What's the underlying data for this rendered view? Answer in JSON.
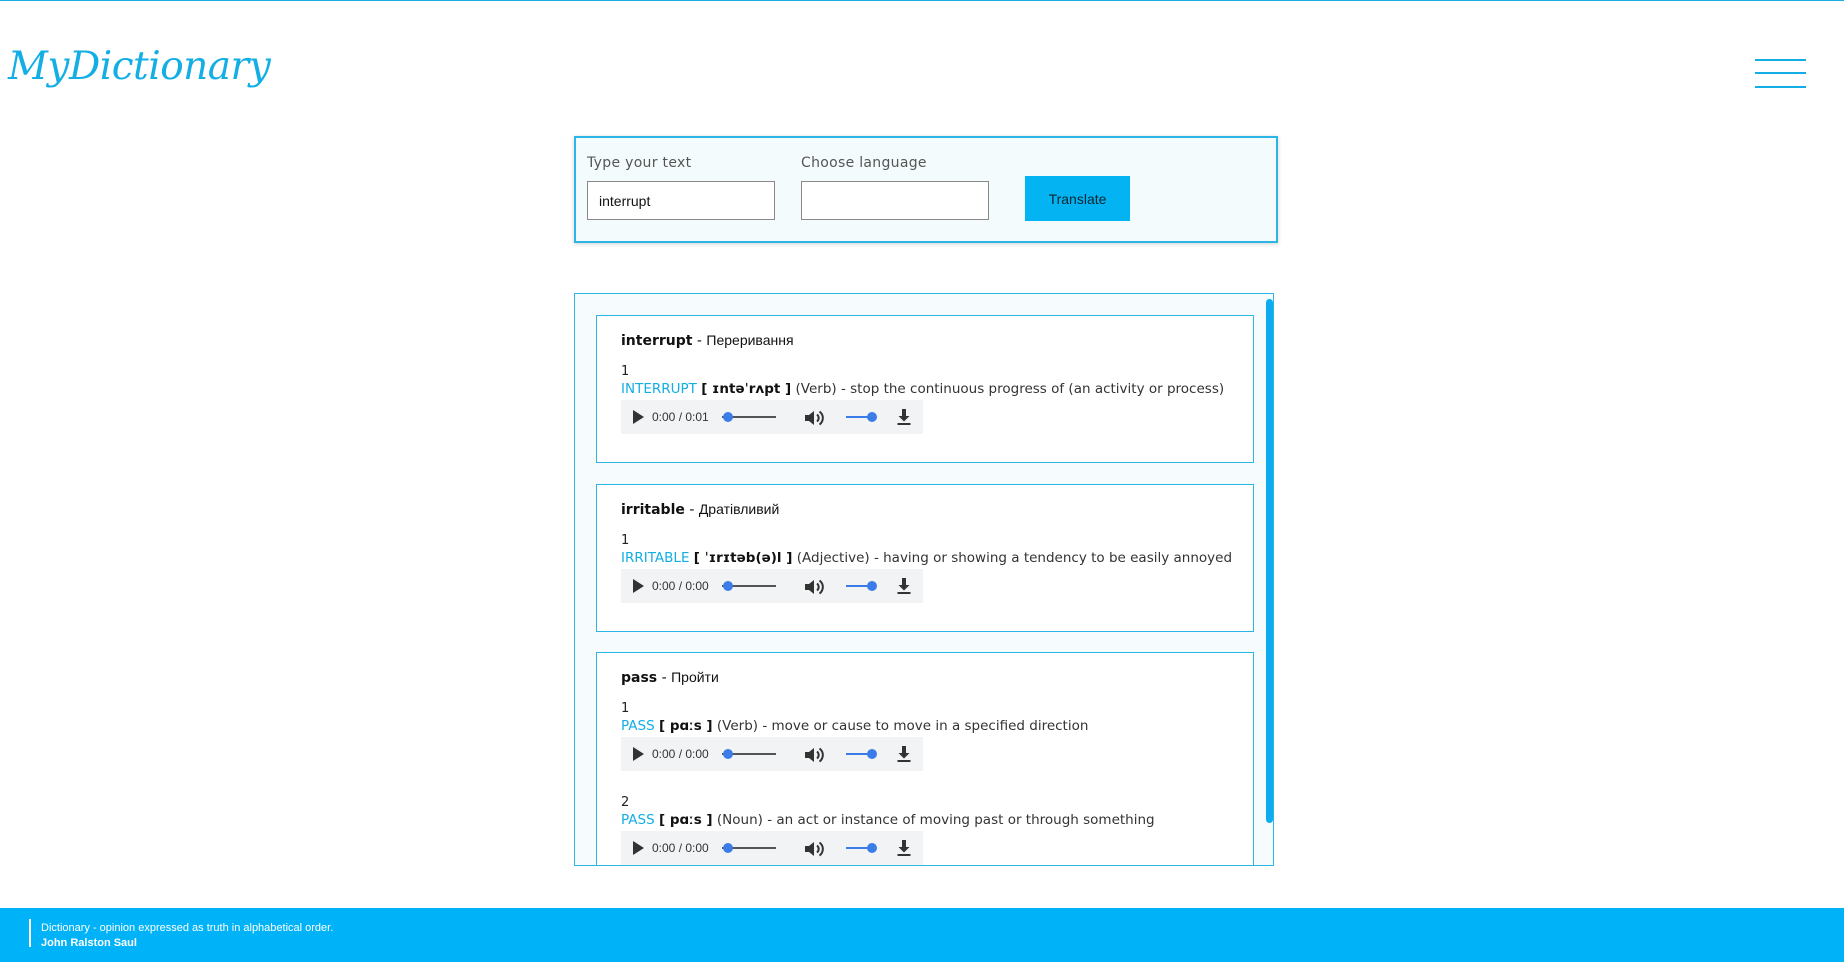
{
  "app": {
    "logo": "MyDictionary"
  },
  "search": {
    "text_label": "Type your text",
    "text_value": "interrupt",
    "language_label": "Choose language",
    "language_value": "",
    "button_label": "Translate"
  },
  "results": [
    {
      "word": "interrupt",
      "separator": " - ",
      "translation": "Переривання",
      "definitions": [
        {
          "number": "1",
          "headword": "INTERRUPT",
          "phonetic": "[ ɪntəˈrʌpt ]",
          "pos": "(Verb)",
          "meaning": "- stop the continuous progress of (an activity or process)",
          "time": "0:00 / 0:01"
        }
      ]
    },
    {
      "word": "irritable",
      "separator": " - ",
      "translation": "Дратівливий",
      "definitions": [
        {
          "number": "1",
          "headword": "IRRITABLE",
          "phonetic": "[ ˈɪrɪtəb(ə)l ]",
          "pos": "(Adjective)",
          "meaning": "- having or showing a tendency to be easily annoyed",
          "time": "0:00 / 0:00"
        }
      ]
    },
    {
      "word": "pass",
      "separator": " - ",
      "translation": "Пройти",
      "definitions": [
        {
          "number": "1",
          "headword": "PASS",
          "phonetic": "[ pɑːs ]",
          "pos": "(Verb)",
          "meaning": "- move or cause to move in a specified direction",
          "time": "0:00 / 0:00"
        },
        {
          "number": "2",
          "headword": "PASS",
          "phonetic": "[ pɑːs ]",
          "pos": "(Noun)",
          "meaning": "- an act or instance of moving past or through something",
          "time": "0:00 / 0:00"
        }
      ]
    }
  ],
  "footer": {
    "quote": "Dictionary - opinion expressed as truth in alphabetical order.",
    "author": "John Ralston Saul"
  },
  "icons": {
    "menu": "hamburger-menu-icon",
    "play": "play-icon",
    "volume": "volume-icon",
    "download": "download-icon"
  },
  "colors": {
    "accent": "#12aee4",
    "button": "#04b4f2",
    "footer": "#00b3f9",
    "player_slider": "#3b7de8"
  },
  "audio_state": {
    "progress_fraction": 0,
    "volume_fraction": 1
  }
}
